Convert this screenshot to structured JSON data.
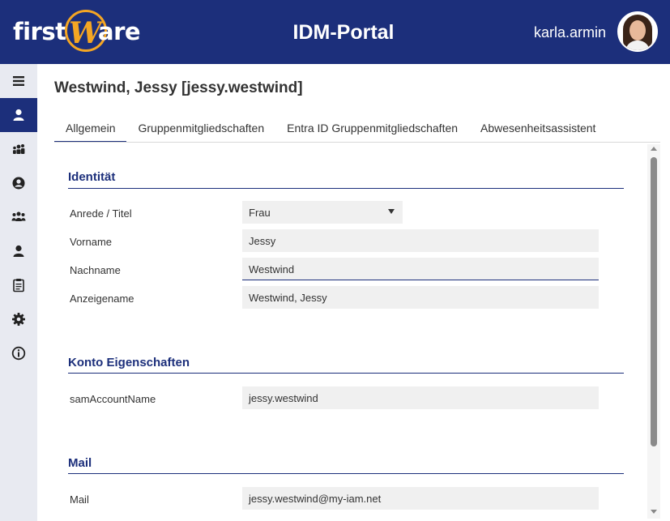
{
  "header": {
    "logo_left": "first",
    "logo_mid": "W",
    "logo_right": "are",
    "title": "IDM-Portal",
    "user": "karla.armin"
  },
  "sidebar": {
    "items": [
      {
        "icon": "menu-icon",
        "active": false
      },
      {
        "icon": "user-icon",
        "active": true
      },
      {
        "icon": "groups-icon",
        "active": false
      },
      {
        "icon": "account-circle-icon",
        "active": false
      },
      {
        "icon": "team-icon",
        "active": false
      },
      {
        "icon": "person-icon",
        "active": false
      },
      {
        "icon": "clipboard-icon",
        "active": false
      },
      {
        "icon": "gear-icon",
        "active": false
      },
      {
        "icon": "info-icon",
        "active": false
      }
    ]
  },
  "main": {
    "title": "Westwind, Jessy [jessy.westwind]",
    "tabs": [
      {
        "label": "Allgemein",
        "active": true
      },
      {
        "label": "Gruppenmitgliedschaften",
        "active": false
      },
      {
        "label": "Entra ID Gruppenmitgliedschaften",
        "active": false
      },
      {
        "label": "Abwesenheitsassistent",
        "active": false
      }
    ],
    "sections": {
      "identitaet": {
        "title": "Identität",
        "anrede_label": "Anrede / Titel",
        "anrede_value": "Frau",
        "vorname_label": "Vorname",
        "vorname_value": "Jessy",
        "nachname_label": "Nachname",
        "nachname_value": "Westwind",
        "anzeigename_label": "Anzeigename",
        "anzeigename_value": "Westwind, Jessy"
      },
      "konto": {
        "title": "Konto Eigenschaften",
        "sam_label": "samAccountName",
        "sam_value": "jessy.westwind"
      },
      "mail": {
        "title": "Mail",
        "mail_label": "Mail",
        "mail_value": "jessy.westwind@my-iam.net"
      }
    }
  },
  "colors": {
    "brand": "#1c2f7b",
    "accent": "#f5a623"
  }
}
